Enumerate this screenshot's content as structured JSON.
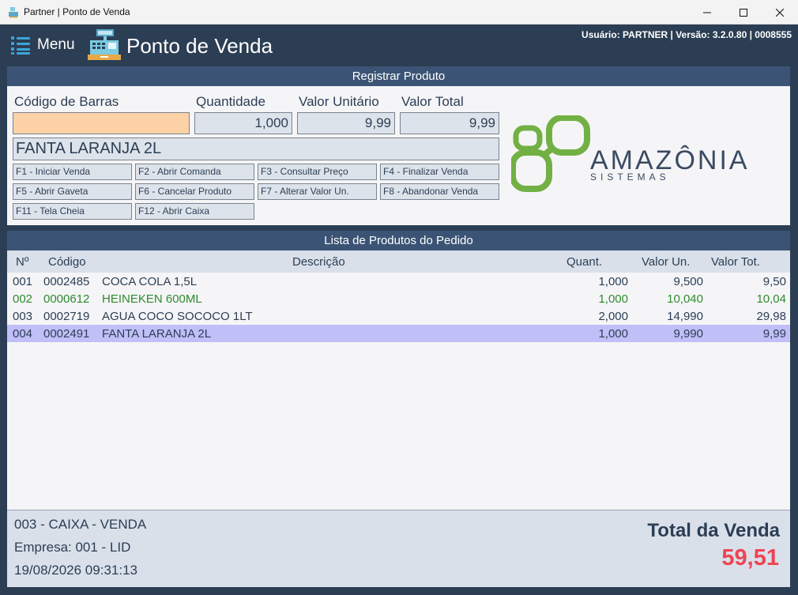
{
  "window": {
    "title": "Partner | Ponto de Venda"
  },
  "header": {
    "menu_label": "Menu",
    "page_title": "Ponto de Venda",
    "user_info": "Usuário: PARTNER | Versão: 3.2.0.80 | 0008555"
  },
  "register": {
    "title": "Registrar Produto",
    "barcode_label": "Código de Barras",
    "barcode_value": "",
    "qty_label": "Quantidade",
    "qty_value": "1,000",
    "unit_label": "Valor Unitário",
    "unit_value": "9,99",
    "total_label": "Valor Total",
    "total_value": "9,99",
    "product_desc": "FANTA LARANJA 2L",
    "fkeys": [
      "F1 - Iniciar Venda",
      "F2 - Abrir Comanda",
      "F3 - Consultar Preço",
      "F4 - Finalizar Venda",
      "F5 - Abrir Gaveta",
      "F6 - Cancelar Produto",
      "F7 - Alterar Valor Un.",
      "F8 - Abandonar Venda",
      "F11 - Tela Cheia",
      "F12 - Abrir Caixa"
    ]
  },
  "logo": {
    "name": "AMAZÔNIA",
    "sub": "SISTEMAS"
  },
  "list": {
    "title": "Lista de Produtos do Pedido",
    "columns": [
      "Nº",
      "Código",
      "Descrição",
      "Quant.",
      "Valor Un.",
      "Valor Tot."
    ],
    "rows": [
      {
        "n": "001",
        "code": "0002485",
        "desc": "COCA COLA 1,5L",
        "qty": "1,000",
        "unit": "9,500",
        "total": "9,50"
      },
      {
        "n": "002",
        "code": "0000612",
        "desc": "HEINEKEN 600ML",
        "qty": "1,000",
        "unit": "10,040",
        "total": "10,04"
      },
      {
        "n": "003",
        "code": "0002719",
        "desc": "AGUA COCO SOCOCO 1LT",
        "qty": "2,000",
        "unit": "14,990",
        "total": "29,98"
      },
      {
        "n": "004",
        "code": "0002491",
        "desc": "FANTA LARANJA 2L",
        "qty": "1,000",
        "unit": "9,990",
        "total": "9,99"
      }
    ]
  },
  "footer": {
    "caixa": "003 - CAIXA - VENDA",
    "empresa": "Empresa: 001 - LID",
    "datetime": "19/08/2026 09:31:13",
    "total_label": "Total da Venda",
    "total_value": "59,51"
  },
  "colors": {
    "accent": "#2c3e54",
    "panel_header": "#3b5475",
    "barcode_bg": "#fdd2a7",
    "selected_row": "#c0bff8",
    "total_red": "#ee4455",
    "logo_green": "#72b044"
  }
}
